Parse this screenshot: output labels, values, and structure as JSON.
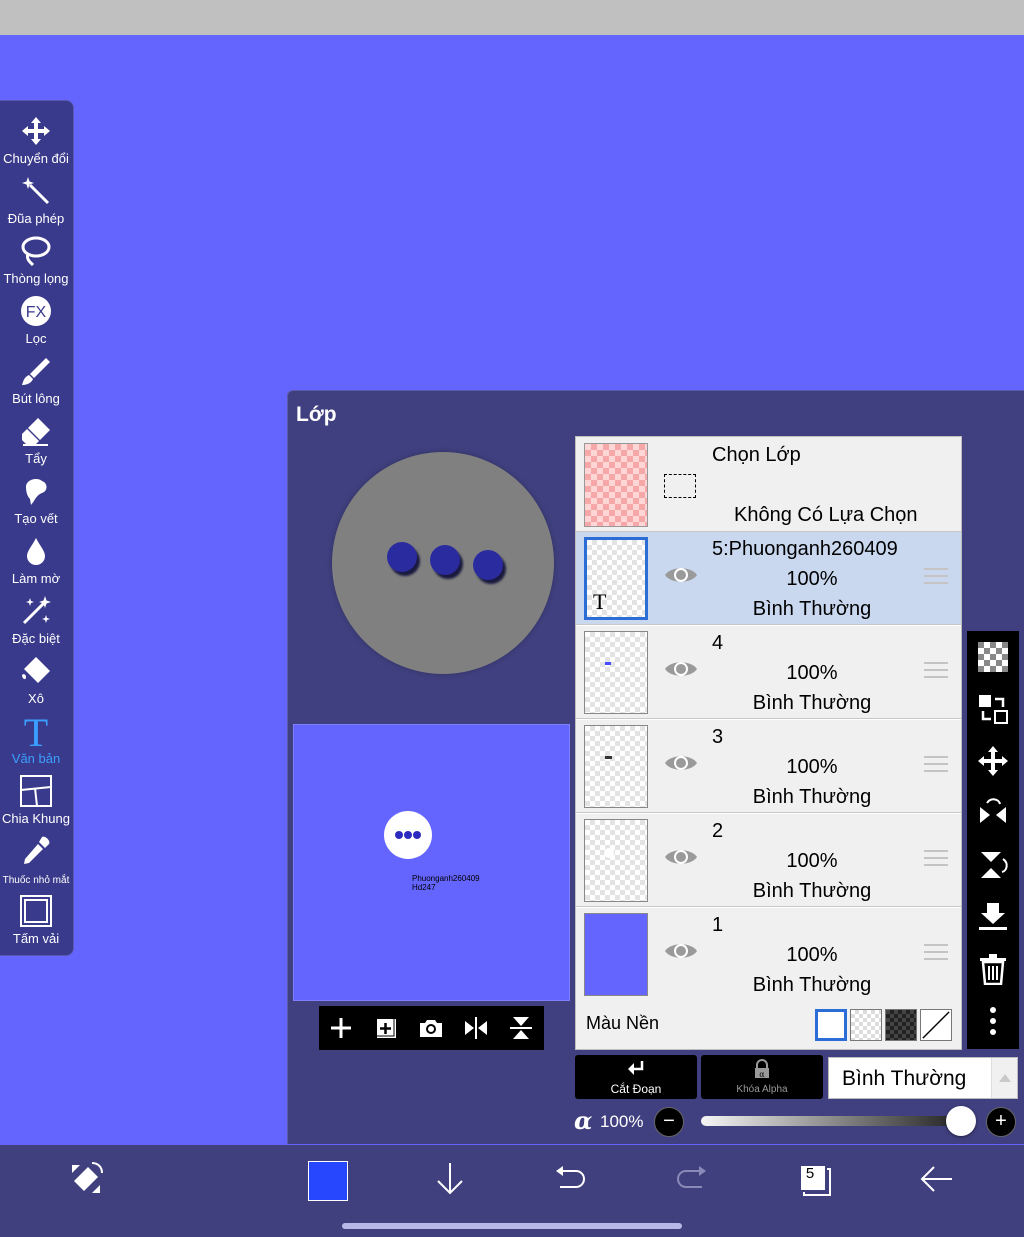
{
  "toolbar": {
    "tools": [
      {
        "label": "Chuyển đổi",
        "icon": "move-arrows-icon"
      },
      {
        "label": "Đũa phép",
        "icon": "magic-wand-icon"
      },
      {
        "label": "Thòng lọng",
        "icon": "lasso-icon"
      },
      {
        "label": "Lọc",
        "icon": "fx-filter-icon"
      },
      {
        "label": "Bút lông",
        "icon": "brush-icon"
      },
      {
        "label": "Tẩy",
        "icon": "eraser-icon"
      },
      {
        "label": "Tạo vết",
        "icon": "smudge-icon"
      },
      {
        "label": "Làm mờ",
        "icon": "blur-drop-icon"
      },
      {
        "label": "Đặc biệt",
        "icon": "special-brush-icon"
      },
      {
        "label": "Xô",
        "icon": "bucket-icon"
      },
      {
        "label": "Văn bản",
        "icon": "text-icon",
        "active": true
      },
      {
        "label": "Chia Khung",
        "icon": "frame-divider-icon"
      },
      {
        "label": "Thuốc nhỏ mắt",
        "icon": "eyedropper-icon"
      },
      {
        "label": "Tấm vải",
        "icon": "canvas-icon"
      }
    ]
  },
  "layer_panel": {
    "title": "Lớp",
    "thumbnail_text": [
      "Phuonganh260409",
      "Hd247"
    ],
    "selection": {
      "title": "Chọn Lớp",
      "subtitle": "Không Có Lựa Chọn"
    },
    "layers": [
      {
        "name": "5:Phuonganh260409",
        "opacity": "100%",
        "mode": "Bình Thường",
        "selected": true,
        "text_layer": true
      },
      {
        "name": "4",
        "opacity": "100%",
        "mode": "Bình Thường"
      },
      {
        "name": "3",
        "opacity": "100%",
        "mode": "Bình Thường"
      },
      {
        "name": "2",
        "opacity": "100%",
        "mode": "Bình Thường"
      },
      {
        "name": "1",
        "opacity": "100%",
        "mode": "Bình Thường"
      }
    ],
    "background": {
      "label": "Màu Nền"
    },
    "clip_label": "Cắt Đoạn",
    "alpha_lock_label": "Khóa Alpha",
    "blend_mode": "Bình Thường",
    "alpha_symbol": "α",
    "alpha_value": "100%",
    "alpha_level": 1.0
  },
  "bottom_bar": {
    "current_color": "#2747ff",
    "layer_count": "5"
  },
  "colors": {
    "canvas": "#6464ff",
    "panel": "#404080",
    "accent": "#2a6dd6",
    "active_tool": "#3aa0ff"
  }
}
